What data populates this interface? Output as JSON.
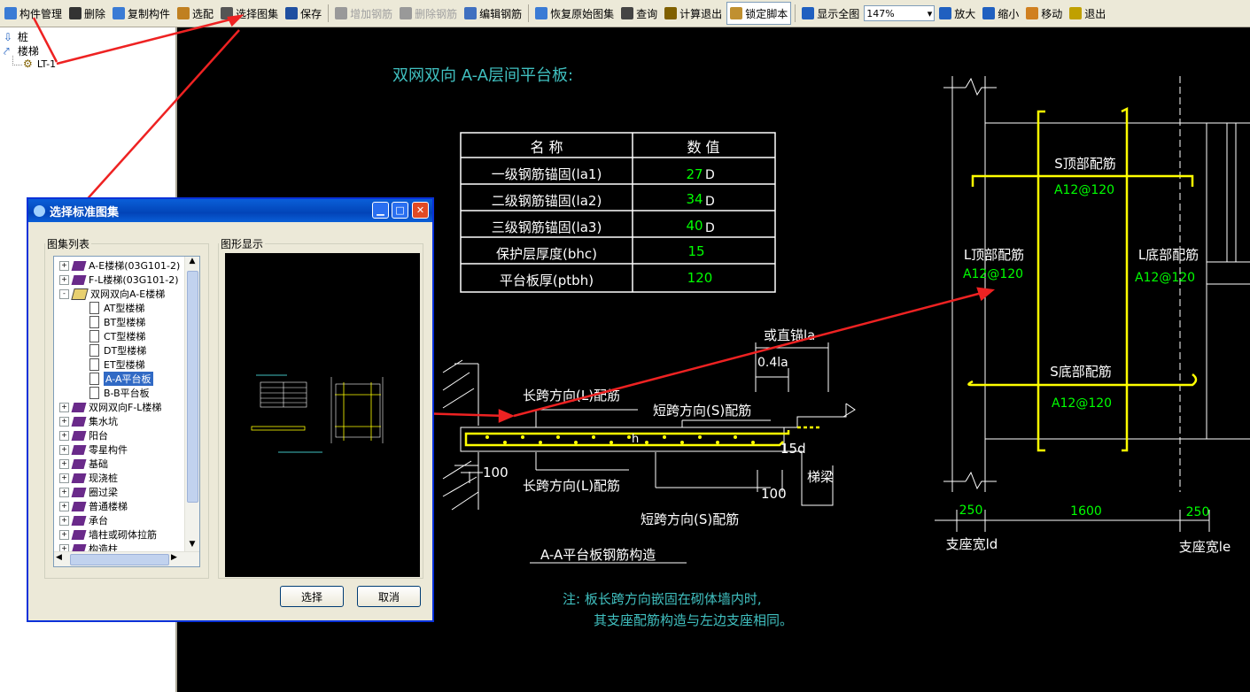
{
  "toolbar": {
    "items": [
      {
        "label": "构件管理",
        "icon": "component-manage-icon",
        "enabled": true
      },
      {
        "label": "删除",
        "icon": "delete-x-icon",
        "enabled": true
      },
      {
        "label": "复制构件",
        "icon": "copy-icon",
        "enabled": true
      },
      {
        "label": "选配",
        "icon": "select-config-icon",
        "enabled": true
      },
      {
        "label": "选择图集",
        "icon": "atlas-icon",
        "enabled": true
      },
      {
        "label": "保存",
        "icon": "save-disk-icon",
        "enabled": true
      },
      {
        "label": "增加钢筋",
        "icon": "add-rebar-icon",
        "enabled": false
      },
      {
        "label": "删除钢筋",
        "icon": "delete-rebar-icon",
        "enabled": false
      },
      {
        "label": "编辑钢筋",
        "icon": "edit-rebar-icon",
        "enabled": true
      },
      {
        "label": "恢复原始图集",
        "icon": "restore-icon",
        "enabled": true
      },
      {
        "label": "查询",
        "icon": "binoculars-icon",
        "enabled": true
      },
      {
        "label": "计算退出",
        "icon": "calc-exit-icon",
        "enabled": true
      },
      {
        "label": "锁定脚本",
        "icon": "lock-icon",
        "enabled": true,
        "pressed": true
      },
      {
        "label": "显示全图",
        "icon": "zoom-all-icon",
        "enabled": true
      },
      {
        "label": "放大",
        "icon": "zoom-in-icon",
        "enabled": true
      },
      {
        "label": "缩小",
        "icon": "zoom-out-icon",
        "enabled": true
      },
      {
        "label": "移动",
        "icon": "move-hand-icon",
        "enabled": true
      },
      {
        "label": "退出",
        "icon": "exit-icon",
        "enabled": true
      }
    ],
    "zoom_value": "147%"
  },
  "tree": {
    "nodes": [
      {
        "label": "桩",
        "icon": "pile-icon"
      },
      {
        "label": "楼梯",
        "icon": "stairs-icon"
      },
      {
        "label": "LT-1",
        "icon": "gear-icon"
      }
    ]
  },
  "drawing": {
    "title": "双网双向 A-A层间平台板:",
    "table": {
      "headers": [
        "名  称",
        "数  值"
      ],
      "rows": [
        {
          "name": "一级钢筋锚固(la1)",
          "value": "27",
          "unit": "D"
        },
        {
          "name": "二级钢筋锚固(la2)",
          "value": "34",
          "unit": "D"
        },
        {
          "name": "三级钢筋锚固(la3)",
          "value": "40",
          "unit": "D"
        },
        {
          "name": "保护层厚度(bhc)",
          "value": "15",
          "unit": ""
        },
        {
          "name": "平台板厚(ptbh)",
          "value": "120",
          "unit": ""
        }
      ]
    },
    "section": {
      "straight_anchor": "或直锚la",
      "anchor_frac": "0.4la",
      "long_top": "长跨方向(L)配筋",
      "short_top": "短跨方向(S)配筋",
      "h": "h",
      "d15": "15d",
      "d100_left": "100",
      "d100_right": "100",
      "long_bottom": "长跨方向(L)配筋",
      "beam": "梯梁",
      "short_bottom": "短跨方向(S)配筋",
      "caption": "A-A平台板钢筋构造"
    },
    "note_line1": "注: 板长跨方向嵌固在砌体墙内时,",
    "note_line2": "其支座配筋构造与左边支座相同。",
    "plan": {
      "s_top": "S顶部配筋",
      "s_top_val": "A12@120",
      "l_top": "L顶部配筋",
      "l_top_val": "A12@120",
      "l_bot": "L底部配筋",
      "l_bot_val": "A12@120",
      "s_bot": "S底部配筋",
      "s_bot_val": "A12@120",
      "dim_left": "250",
      "dim_mid": "1600",
      "dim_right": "250",
      "support_left": "支座宽ld",
      "support_right": "支座宽le"
    },
    "colors": {
      "cyan": "#40c0c0",
      "yellow": "#ffff00",
      "green": "#00ff00",
      "white": "#ffffff",
      "red": "#ee2222"
    }
  },
  "dialog": {
    "title": "选择标准图集",
    "list_group": "图集列表",
    "preview_group": "图形显示",
    "list_items": [
      {
        "label": "A-E楼梯(03G101-2)",
        "level": 0,
        "type": "book",
        "expand": "+"
      },
      {
        "label": "F-L楼梯(03G101-2)",
        "level": 0,
        "type": "book",
        "expand": "+"
      },
      {
        "label": "双网双向A-E楼梯",
        "level": 0,
        "type": "openbook",
        "expand": "-"
      },
      {
        "label": "AT型楼梯",
        "level": 1,
        "type": "doc"
      },
      {
        "label": "BT型楼梯",
        "level": 1,
        "type": "doc"
      },
      {
        "label": "CT型楼梯",
        "level": 1,
        "type": "doc"
      },
      {
        "label": "DT型楼梯",
        "level": 1,
        "type": "doc"
      },
      {
        "label": "ET型楼梯",
        "level": 1,
        "type": "doc"
      },
      {
        "label": "A-A平台板",
        "level": 1,
        "type": "doc",
        "selected": true
      },
      {
        "label": "B-B平台板",
        "level": 1,
        "type": "doc"
      },
      {
        "label": "双网双向F-L楼梯",
        "level": 0,
        "type": "book",
        "expand": "+"
      },
      {
        "label": "集水坑",
        "level": 0,
        "type": "book",
        "expand": "+"
      },
      {
        "label": "阳台",
        "level": 0,
        "type": "book",
        "expand": "+"
      },
      {
        "label": "零星构件",
        "level": 0,
        "type": "book",
        "expand": "+"
      },
      {
        "label": "基础",
        "level": 0,
        "type": "book",
        "expand": "+"
      },
      {
        "label": "现浇桩",
        "level": 0,
        "type": "book",
        "expand": "+"
      },
      {
        "label": "圈过梁",
        "level": 0,
        "type": "book",
        "expand": "+"
      },
      {
        "label": "普通楼梯",
        "level": 0,
        "type": "book",
        "expand": "+"
      },
      {
        "label": "承台",
        "level": 0,
        "type": "book",
        "expand": "+"
      },
      {
        "label": "墙柱或砌体拉筋",
        "level": 0,
        "type": "book",
        "expand": "+"
      },
      {
        "label": "构造柱",
        "level": 0,
        "type": "book",
        "expand": "+"
      }
    ],
    "ok_label": "选择",
    "cancel_label": "取消"
  }
}
